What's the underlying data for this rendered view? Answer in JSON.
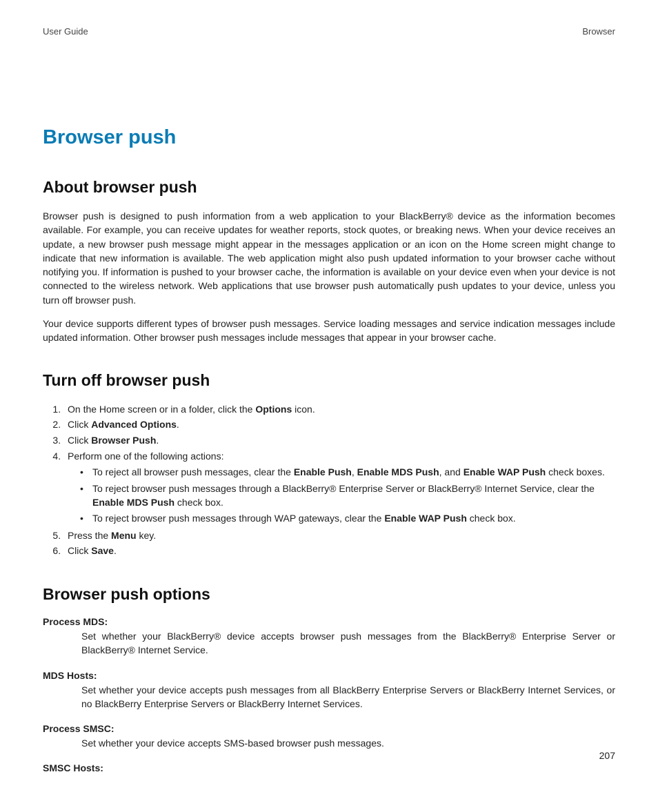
{
  "header": {
    "left": "User Guide",
    "right": "Browser"
  },
  "title": "Browser push",
  "section1": {
    "heading": "About browser push",
    "p1": "Browser push is designed to push information from a web application to your BlackBerry® device as the information becomes available. For example, you can receive updates for weather reports, stock quotes, or breaking news. When your device receives an update, a new browser push message might appear in the messages application or an icon on the Home screen might change to indicate that new information is available. The web application might also push updated information to your browser cache without notifying you. If information is pushed to your browser cache, the information is available on your device even when your device is not connected to the wireless network. Web applications that use browser push automatically push updates to your device, unless you turn off browser push.",
    "p2": "Your device supports different types of browser push messages. Service loading messages and service indication messages include updated information. Other browser push messages include messages that appear in your browser cache."
  },
  "section2": {
    "heading": "Turn off browser push",
    "step1_a": "On the Home screen or in a folder, click the ",
    "step1_b": "Options",
    "step1_c": " icon.",
    "step2_a": "Click ",
    "step2_b": "Advanced Options",
    "step2_c": ".",
    "step3_a": "Click ",
    "step3_b": "Browser Push",
    "step3_c": ".",
    "step4": "Perform one of the following actions:",
    "b1_a": "To reject all browser push messages, clear the ",
    "b1_b": "Enable Push",
    "b1_c": ", ",
    "b1_d": "Enable MDS Push",
    "b1_e": ", and ",
    "b1_f": "Enable WAP Push",
    "b1_g": " check boxes.",
    "b2_a": "To reject browser push messages through a BlackBerry® Enterprise Server or BlackBerry® Internet Service, clear the ",
    "b2_b": "Enable MDS Push",
    "b2_c": " check box.",
    "b3_a": "To reject browser push messages through WAP gateways, clear the ",
    "b3_b": "Enable WAP Push",
    "b3_c": " check box.",
    "step5_a": "Press the ",
    "step5_b": "Menu",
    "step5_c": " key.",
    "step6_a": "Click ",
    "step6_b": "Save",
    "step6_c": "."
  },
  "section3": {
    "heading": "Browser push options",
    "opt1_term": "Process MDS:",
    "opt1_desc": "Set whether your BlackBerry® device accepts browser push messages from the BlackBerry® Enterprise Server or BlackBerry® Internet Service.",
    "opt2_term": "MDS Hosts:",
    "opt2_desc": "Set whether your device accepts push messages from all BlackBerry Enterprise Servers or BlackBerry Internet Services, or no BlackBerry Enterprise Servers or BlackBerry Internet Services.",
    "opt3_term": "Process SMSC:",
    "opt3_desc": "Set whether your device accepts SMS-based browser push messages.",
    "opt4_term": "SMSC Hosts:"
  },
  "page_number": "207"
}
